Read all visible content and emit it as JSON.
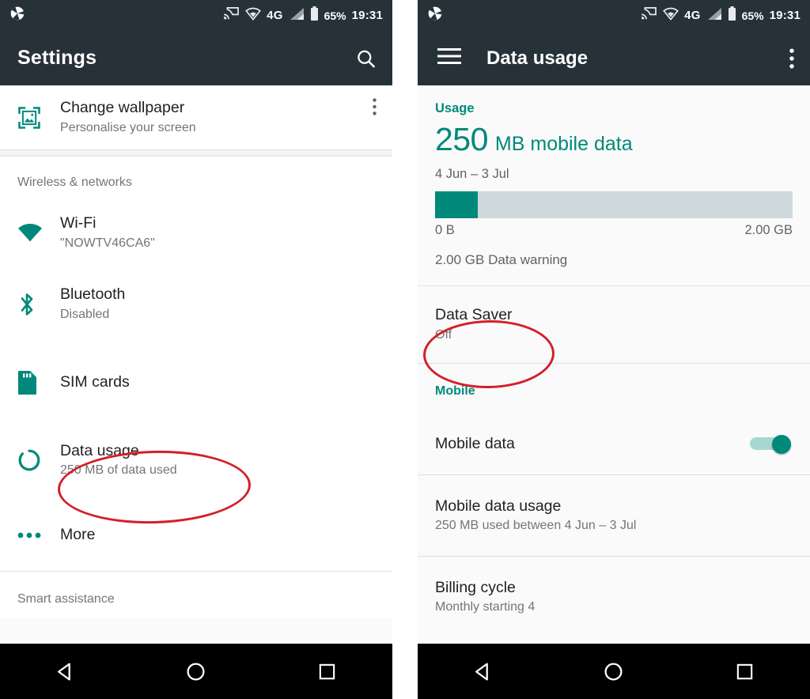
{
  "status_bar": {
    "camera_icon": "aperture-icon",
    "cast_icon": "cast-icon",
    "wifi_icon": "wifi-icon",
    "network_type": "4G",
    "signal_icon": "signal-icon",
    "battery_icon": "battery-icon",
    "battery_percent": "65%",
    "clock": "19:31"
  },
  "left_phone": {
    "appbar": {
      "title": "Settings",
      "search_icon": "search-icon"
    },
    "wallpaper_row": {
      "icon": "wallpaper-image-icon",
      "title": "Change wallpaper",
      "subtitle": "Personalise your screen",
      "overflow_icon": "overflow-menu-icon"
    },
    "sections": [
      {
        "header": "Wireless & networks",
        "items": [
          {
            "icon": "wifi-icon",
            "title": "Wi-Fi",
            "subtitle": "\"NOWTV46CA6\""
          },
          {
            "icon": "bluetooth-icon",
            "title": "Bluetooth",
            "subtitle": "Disabled"
          },
          {
            "icon": "sim-card-icon",
            "title": "SIM cards",
            "subtitle": ""
          },
          {
            "icon": "data-usage-icon",
            "title": "Data usage",
            "subtitle": "250 MB of data used"
          },
          {
            "icon": "more-dots-icon",
            "title": "More",
            "subtitle": ""
          }
        ]
      },
      {
        "header": "Smart assistance",
        "items": []
      }
    ]
  },
  "right_phone": {
    "appbar": {
      "menu_icon": "hamburger-menu-icon",
      "title": "Data usage",
      "overflow_icon": "overflow-menu-icon"
    },
    "usage": {
      "label": "Usage",
      "amount": "250",
      "unit": "MB mobile data",
      "date_range": "4 Jun – 3 Jul",
      "bar_min_label": "0 B",
      "bar_max_label": "2.00 GB",
      "bar_fill_percent": 12,
      "warning": "2.00 GB Data warning"
    },
    "data_saver": {
      "title": "Data Saver",
      "subtitle": "Off"
    },
    "mobile_section": {
      "header": "Mobile",
      "items": [
        {
          "title": "Mobile data",
          "subtitle": "",
          "toggle": "on"
        },
        {
          "title": "Mobile data usage",
          "subtitle": "250 MB used between 4 Jun – 3 Jul"
        },
        {
          "title": "Billing cycle",
          "subtitle": "Monthly starting 4"
        }
      ]
    }
  },
  "nav_bar": {
    "back_icon": "back-triangle-icon",
    "home_icon": "home-circle-icon",
    "recents_icon": "recents-square-icon"
  },
  "annotations": [
    {
      "name": "data-usage-highlight",
      "shape": "ellipse",
      "color": "#d32029"
    },
    {
      "name": "data-saver-highlight",
      "shape": "ellipse",
      "color": "#d32029"
    }
  ],
  "colors": {
    "accent_teal": "#00897b",
    "appbar_dark": "#263238",
    "annotation_red": "#d32029",
    "nav_black": "#000000"
  }
}
